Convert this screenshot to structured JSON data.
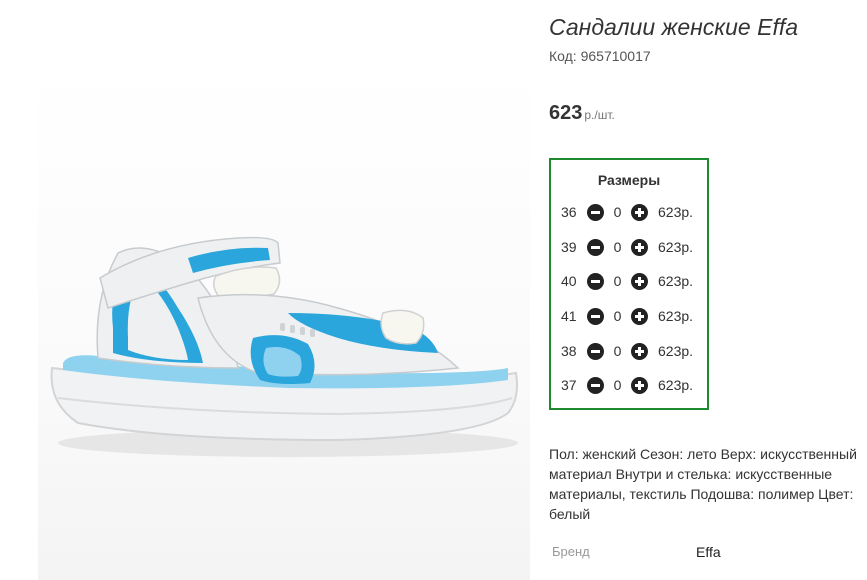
{
  "product": {
    "title": "Сандалии женские Effa",
    "code": "Код: 965710017",
    "price": "623",
    "price_unit": "р./шт."
  },
  "sizes": {
    "heading": "Размеры",
    "rows": [
      {
        "size": "36",
        "qty": "0",
        "price": "623р."
      },
      {
        "size": "39",
        "qty": "0",
        "price": "623р."
      },
      {
        "size": "40",
        "qty": "0",
        "price": "623р."
      },
      {
        "size": "41",
        "qty": "0",
        "price": "623р."
      },
      {
        "size": "38",
        "qty": "0",
        "price": "623р."
      },
      {
        "size": "37",
        "qty": "0",
        "price": "623р."
      }
    ]
  },
  "description": "Пол: женский Сезон: лето Верх: искусственный материал Внутри и стелька: искусственные материалы, текстиль Подошва: полимер Цвет: белый",
  "brand": {
    "label": "Бренд",
    "value": "Effa"
  },
  "colors": {
    "accent_border": "#1e8a2e",
    "sandal_blue": "#2aa6dc",
    "sandal_white": "#eef0f1"
  },
  "icons": {
    "minus": "minus-circle-icon",
    "plus": "plus-circle-icon"
  }
}
